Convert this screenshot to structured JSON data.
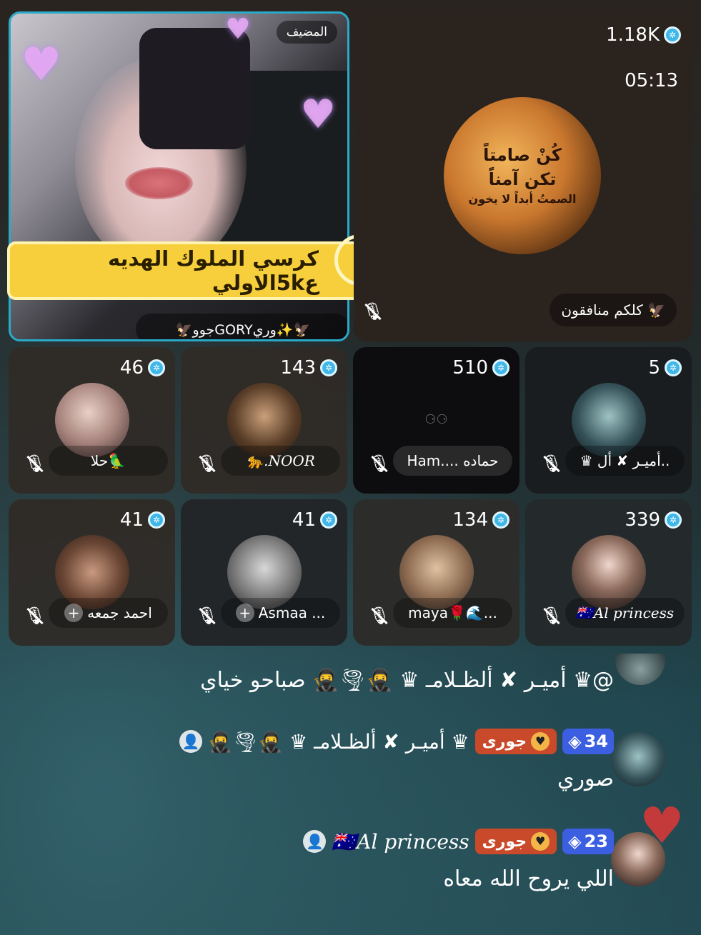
{
  "host": {
    "tag": "المضيف",
    "banner": "كرسي الملوك الهديه ع5kالاولي",
    "name": "🦅جووGORYوري✨🦅"
  },
  "main_seat": {
    "viewers": "1.18K",
    "timer": "05:13",
    "avatar_text": [
      "كُنْ صامتاً",
      "تكن آمناً",
      "الصمتُ أبداً لا يخون"
    ],
    "name": "كلكم منافقون 🦅"
  },
  "seats": [
    {
      "count": "46",
      "name": "حلا🦜"
    },
    {
      "count": "143",
      "name": "🐆.NOOR"
    },
    {
      "count": "510",
      "name": "Ham.... حماده"
    },
    {
      "count": "5",
      "name": "♛ أميـر ✘ أل.."
    },
    {
      "count": "41",
      "name": "احمد جمعه"
    },
    {
      "count": "41",
      "name": "Asmaa ..."
    },
    {
      "count": "134",
      "name": "maya🌹🌊..."
    },
    {
      "count": "339",
      "name": "🇦🇺Al princess"
    }
  ],
  "chat": [
    {
      "text": "@♛ أميـر ✘ ألظـلامـ ♛ 🥷🌪🥷 صباحو خياي"
    },
    {
      "level": "34",
      "badge": "جورى",
      "name": "♛ أميـر ✘ ألظـلامـ ♛ 🥷🌪🥷",
      "text": "صوري"
    },
    {
      "level": "23",
      "badge": "جورى",
      "name": "🇦🇺Al princess",
      "text": "اللي يروح الله معاه"
    }
  ],
  "colors": {
    "host_border": "#2aa9c9",
    "banner": "#f7cf3c",
    "level": "#3b5fe0",
    "badge": "#c94a2a"
  }
}
